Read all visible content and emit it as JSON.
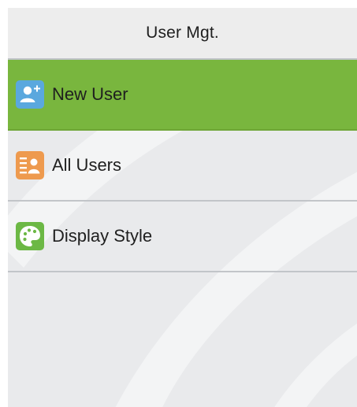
{
  "header": {
    "title": "User Mgt."
  },
  "menu": {
    "items": [
      {
        "label": "New User",
        "icon": "add-user-icon",
        "icon_color": "#5aa8de",
        "selected": true
      },
      {
        "label": "All Users",
        "icon": "user-list-icon",
        "icon_color": "#ee9a4e",
        "selected": false
      },
      {
        "label": "Display Style",
        "icon": "palette-icon",
        "icon_color": "#6cb845",
        "selected": false
      }
    ]
  },
  "colors": {
    "selected_row": "#79b63e",
    "background": "#e9eaec",
    "divider": "#c2c5c9"
  }
}
